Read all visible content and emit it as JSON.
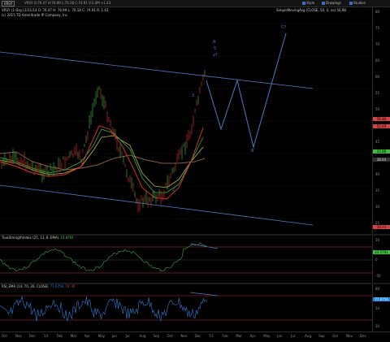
{
  "header": {
    "symbol": "VRSY",
    "quote": "VRSY  O:76.47  H:76.99  L:70.18  C:74.91  V:1.4M  +1.43",
    "style_label": "Style",
    "drawings_label": "Drawings",
    "studies_label": "Studies",
    "company": "(c) 2015 TD Ameritrade IP Company, Inc."
  },
  "main": {
    "indicator_line": "VRSY (1-Day)  2/11/14  O: 76.47  H: 76.99  L: 70.18  C: 74.91  R: 1.43",
    "sma_label": "SimpleMovingAvg (CLOSE, 50, 0, no)  56.98",
    "y_ticks": [
      "80",
      "75",
      "70",
      "65",
      "60",
      "55",
      "50",
      "45",
      "40",
      "35",
      "30",
      "25",
      "20",
      "15"
    ],
    "price_tags": [
      {
        "label": "56.88",
        "color": "#d04444"
      },
      {
        "label": "52.49",
        "color": "#d04444"
      },
      {
        "label": "43.88",
        "color": "#3fbf3f"
      },
      {
        "label": "38.93",
        "color": "#333333"
      },
      {
        "label": "10.74",
        "color": "#d04444"
      }
    ],
    "wave_labels": {
      "A": "A",
      "five": "5",
      "v": "v?",
      "C": "C?",
      "B": "B",
      "three": "3",
      "two": "2"
    }
  },
  "lower1": {
    "title": "TrueStrengthIndex (25, 13, 8, EMA)",
    "v1": "23.8791",
    "v2": "18.4",
    "v3": "-23.5",
    "y_ticks": [
      "50",
      "25",
      "0",
      "-25",
      "-50"
    ],
    "tag": "23.5791"
  },
  "lower2": {
    "title": "RSI_EMA (14, 70, 30, CLOSE)",
    "v1": "77.6756",
    "v2": "70",
    "v3": "30",
    "y_ticks": [
      "80",
      "70",
      "50",
      "30",
      "20"
    ],
    "tag": "77.6756"
  },
  "xaxis": {
    "labels": [
      "Oct",
      "Nov",
      "Dec",
      "'14",
      "Feb",
      "Mar",
      "Apr",
      "May",
      "Jun",
      "Jul",
      "Aug",
      "Sep",
      "Oct",
      "Nov",
      "Dec",
      "'15",
      "Feb",
      "Mar",
      "Apr",
      "May",
      "Jun",
      "Jul",
      "Aug",
      "Sep",
      "Oct",
      "Nov",
      "Dec"
    ]
  },
  "colors": {
    "channel": "#4f79c7",
    "wave": "#4f79c7",
    "ma_red": "#d03030",
    "ma_yellow": "#b8b840",
    "ma_brown": "#8a5a3a",
    "ma_green": "#3faa3f"
  },
  "chart_data": {
    "type": "line",
    "series_close_range": [
      20,
      80
    ],
    "ylim": [
      10,
      90
    ]
  }
}
